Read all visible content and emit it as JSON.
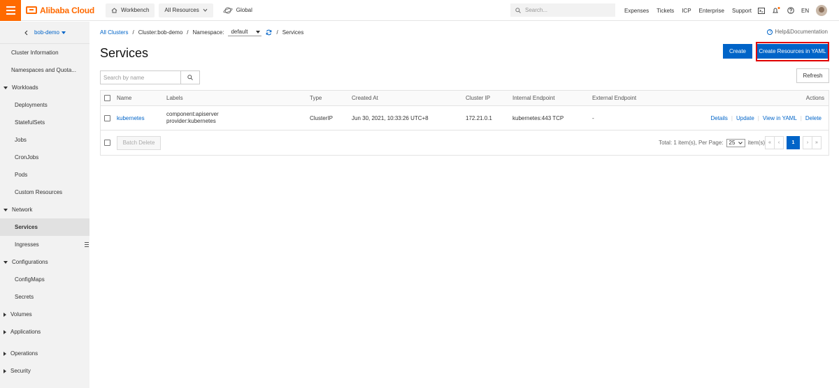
{
  "topbar": {
    "logo_text": "Alibaba Cloud",
    "workbench": "Workbench",
    "all_resources": "All Resources",
    "global": "Global",
    "search_placeholder": "Search...",
    "links": [
      "Expenses",
      "Tickets",
      "ICP",
      "Enterprise",
      "Support"
    ],
    "language": "EN",
    "brand_color": "#ff6a00"
  },
  "sidebar": {
    "cluster_name": "bob-demo",
    "items": [
      {
        "label": "Cluster Information",
        "kind": "top"
      },
      {
        "label": "Namespaces and Quota...",
        "kind": "top"
      },
      {
        "label": "Workloads",
        "kind": "group-open"
      },
      {
        "label": "Deployments",
        "kind": "sub"
      },
      {
        "label": "StatefulSets",
        "kind": "sub"
      },
      {
        "label": "Jobs",
        "kind": "sub"
      },
      {
        "label": "CronJobs",
        "kind": "sub"
      },
      {
        "label": "Pods",
        "kind": "sub"
      },
      {
        "label": "Custom Resources",
        "kind": "sub"
      },
      {
        "label": "Network",
        "kind": "group-open"
      },
      {
        "label": "Services",
        "kind": "sub-active"
      },
      {
        "label": "Ingresses",
        "kind": "sub"
      },
      {
        "label": "Configurations",
        "kind": "group-open"
      },
      {
        "label": "ConfigMaps",
        "kind": "sub"
      },
      {
        "label": "Secrets",
        "kind": "sub"
      },
      {
        "label": "Volumes",
        "kind": "group-closed"
      },
      {
        "label": "Applications",
        "kind": "group-closed"
      },
      {
        "label": "Operations",
        "kind": "group-closed"
      },
      {
        "label": "Security",
        "kind": "group-closed"
      }
    ]
  },
  "breadcrumb": {
    "all_clusters": "All Clusters",
    "cluster": "Cluster:bob-demo",
    "namespace_label": "Namespace:",
    "namespace_value": "default",
    "current": "Services"
  },
  "help": "Help&Documentation",
  "page_title": "Services",
  "buttons": {
    "create": "Create",
    "create_yaml": "Create Resources in YAML",
    "refresh": "Refresh",
    "batch_delete": "Batch Delete"
  },
  "search": {
    "placeholder": "Search by name"
  },
  "table": {
    "columns": [
      "Name",
      "Labels",
      "Type",
      "Created At",
      "Cluster IP",
      "Internal Endpoint",
      "External Endpoint",
      "Actions"
    ],
    "rows": [
      {
        "name": "kubernetes",
        "labels": [
          "component:apiserver",
          "provider:kubernetes"
        ],
        "type": "ClusterIP",
        "created_at": "Jun 30, 2021, 10:33:26 UTC+8",
        "cluster_ip": "172.21.0.1",
        "internal_endpoint": "kubernetes:443 TCP",
        "external_endpoint": "-",
        "actions": [
          "Details",
          "Update",
          "View in YAML",
          "Delete"
        ]
      }
    ]
  },
  "pagination": {
    "total_text": "Total: 1 item(s), Per Page:",
    "per_page": "25",
    "items_suffix": "item(s)",
    "first": "«",
    "prev": "‹",
    "current_page": "1",
    "next": "›",
    "last": "»"
  }
}
